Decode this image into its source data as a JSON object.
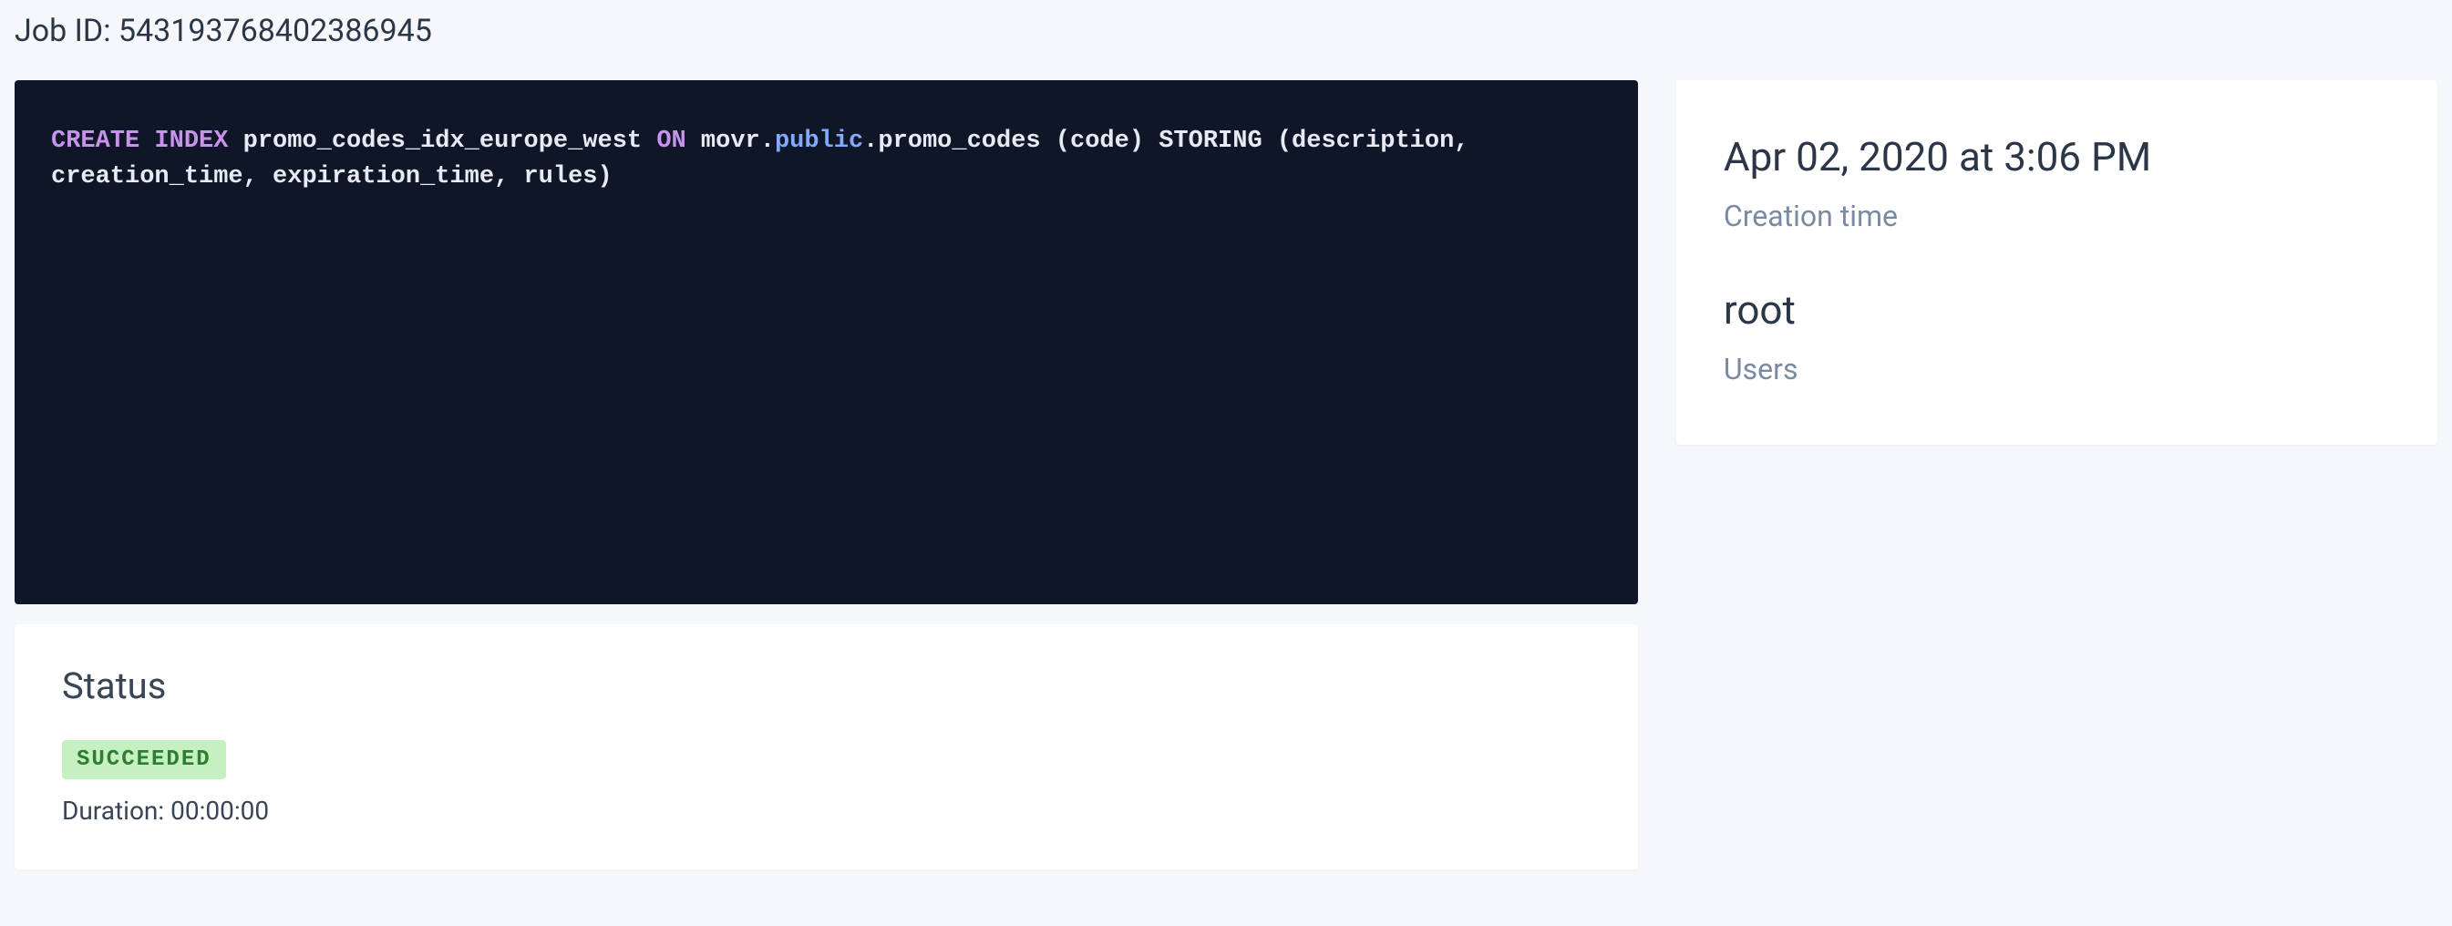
{
  "header": {
    "job_id_prefix": "Job ID: ",
    "job_id": "543193768402386945"
  },
  "sql": {
    "kw_create_index": "CREATE INDEX",
    "index_name": " promo_codes_idx_europe_west ",
    "kw_on": "ON",
    "db_prefix": " movr.",
    "public": "public",
    "rest": ".promo_codes (code) STORING (description, creation_time, expiration_time, rules)"
  },
  "status": {
    "title": "Status",
    "badge": "SUCCEEDED",
    "duration_label": "Duration: ",
    "duration_value": "00:00:00"
  },
  "info": {
    "creation_time_value": "Apr 02, 2020 at 3:06 PM",
    "creation_time_label": "Creation time",
    "users_value": "root",
    "users_label": "Users"
  }
}
